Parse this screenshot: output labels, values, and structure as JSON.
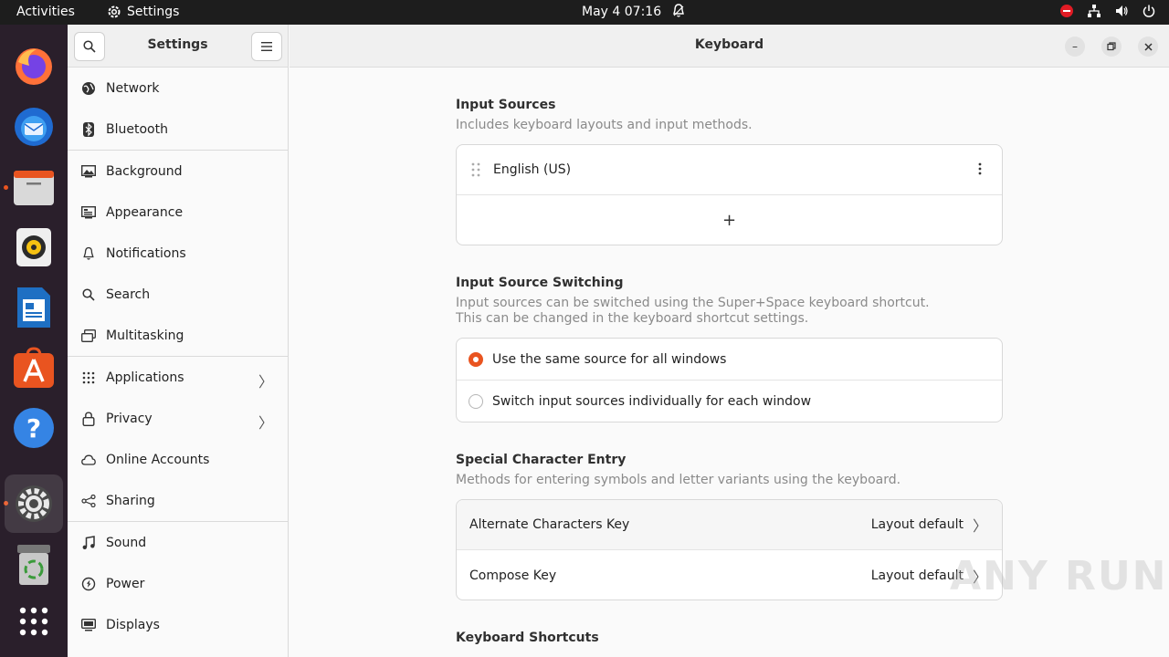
{
  "topbar": {
    "activities": "Activities",
    "app_name": "Settings",
    "datetime": "May 4  07:16"
  },
  "sidebar": {
    "title": "Settings",
    "items": [
      {
        "label": "Network",
        "icon": "globe-icon"
      },
      {
        "label": "Bluetooth",
        "icon": "bluetooth-icon"
      },
      {
        "label": "Background",
        "icon": "background-icon"
      },
      {
        "label": "Appearance",
        "icon": "appearance-icon"
      },
      {
        "label": "Notifications",
        "icon": "bell-icon"
      },
      {
        "label": "Search",
        "icon": "search-icon"
      },
      {
        "label": "Multitasking",
        "icon": "multitasking-icon"
      },
      {
        "label": "Applications",
        "icon": "grid-icon"
      },
      {
        "label": "Privacy",
        "icon": "lock-icon"
      },
      {
        "label": "Online Accounts",
        "icon": "cloud-icon"
      },
      {
        "label": "Sharing",
        "icon": "share-icon"
      },
      {
        "label": "Sound",
        "icon": "music-note-icon"
      },
      {
        "label": "Power",
        "icon": "power-icon"
      },
      {
        "label": "Displays",
        "icon": "display-icon"
      }
    ]
  },
  "main": {
    "title": "Keyboard",
    "input_sources": {
      "title": "Input Sources",
      "description": "Includes keyboard layouts and input methods.",
      "items": [
        "English (US)"
      ],
      "add_label": "+"
    },
    "switching": {
      "title": "Input Source Switching",
      "description_line1": "Input sources can be switched using the Super+Space keyboard shortcut.",
      "description_line2": "This can be changed in the keyboard shortcut settings.",
      "options": [
        {
          "label": "Use the same source for all windows",
          "checked": true
        },
        {
          "label": "Switch input sources individually for each window",
          "checked": false
        }
      ]
    },
    "special_chars": {
      "title": "Special Character Entry",
      "description": "Methods for entering symbols and letter variants using the keyboard.",
      "rows": [
        {
          "label": "Alternate Characters Key",
          "value": "Layout default"
        },
        {
          "label": "Compose Key",
          "value": "Layout default"
        }
      ]
    },
    "shortcuts": {
      "title": "Keyboard Shortcuts"
    }
  },
  "watermark": "ANY RUN",
  "colors": {
    "accent": "#e95420",
    "topbar": "#1d1d1d",
    "dock": "#2a1f2b"
  }
}
